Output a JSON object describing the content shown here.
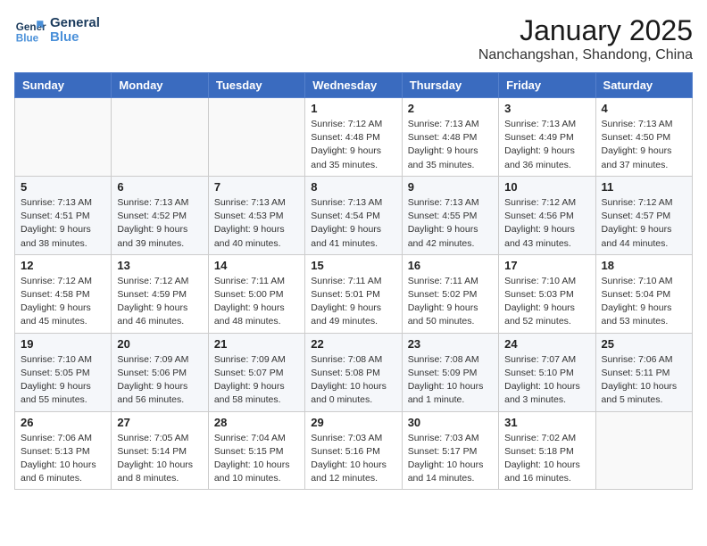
{
  "logo": {
    "line1": "General",
    "line2": "Blue"
  },
  "title": "January 2025",
  "location": "Nanchangshan, Shandong, China",
  "weekdays": [
    "Sunday",
    "Monday",
    "Tuesday",
    "Wednesday",
    "Thursday",
    "Friday",
    "Saturday"
  ],
  "weeks": [
    [
      {
        "day": "",
        "info": ""
      },
      {
        "day": "",
        "info": ""
      },
      {
        "day": "",
        "info": ""
      },
      {
        "day": "1",
        "info": "Sunrise: 7:12 AM\nSunset: 4:48 PM\nDaylight: 9 hours\nand 35 minutes."
      },
      {
        "day": "2",
        "info": "Sunrise: 7:13 AM\nSunset: 4:48 PM\nDaylight: 9 hours\nand 35 minutes."
      },
      {
        "day": "3",
        "info": "Sunrise: 7:13 AM\nSunset: 4:49 PM\nDaylight: 9 hours\nand 36 minutes."
      },
      {
        "day": "4",
        "info": "Sunrise: 7:13 AM\nSunset: 4:50 PM\nDaylight: 9 hours\nand 37 minutes."
      }
    ],
    [
      {
        "day": "5",
        "info": "Sunrise: 7:13 AM\nSunset: 4:51 PM\nDaylight: 9 hours\nand 38 minutes."
      },
      {
        "day": "6",
        "info": "Sunrise: 7:13 AM\nSunset: 4:52 PM\nDaylight: 9 hours\nand 39 minutes."
      },
      {
        "day": "7",
        "info": "Sunrise: 7:13 AM\nSunset: 4:53 PM\nDaylight: 9 hours\nand 40 minutes."
      },
      {
        "day": "8",
        "info": "Sunrise: 7:13 AM\nSunset: 4:54 PM\nDaylight: 9 hours\nand 41 minutes."
      },
      {
        "day": "9",
        "info": "Sunrise: 7:13 AM\nSunset: 4:55 PM\nDaylight: 9 hours\nand 42 minutes."
      },
      {
        "day": "10",
        "info": "Sunrise: 7:12 AM\nSunset: 4:56 PM\nDaylight: 9 hours\nand 43 minutes."
      },
      {
        "day": "11",
        "info": "Sunrise: 7:12 AM\nSunset: 4:57 PM\nDaylight: 9 hours\nand 44 minutes."
      }
    ],
    [
      {
        "day": "12",
        "info": "Sunrise: 7:12 AM\nSunset: 4:58 PM\nDaylight: 9 hours\nand 45 minutes."
      },
      {
        "day": "13",
        "info": "Sunrise: 7:12 AM\nSunset: 4:59 PM\nDaylight: 9 hours\nand 46 minutes."
      },
      {
        "day": "14",
        "info": "Sunrise: 7:11 AM\nSunset: 5:00 PM\nDaylight: 9 hours\nand 48 minutes."
      },
      {
        "day": "15",
        "info": "Sunrise: 7:11 AM\nSunset: 5:01 PM\nDaylight: 9 hours\nand 49 minutes."
      },
      {
        "day": "16",
        "info": "Sunrise: 7:11 AM\nSunset: 5:02 PM\nDaylight: 9 hours\nand 50 minutes."
      },
      {
        "day": "17",
        "info": "Sunrise: 7:10 AM\nSunset: 5:03 PM\nDaylight: 9 hours\nand 52 minutes."
      },
      {
        "day": "18",
        "info": "Sunrise: 7:10 AM\nSunset: 5:04 PM\nDaylight: 9 hours\nand 53 minutes."
      }
    ],
    [
      {
        "day": "19",
        "info": "Sunrise: 7:10 AM\nSunset: 5:05 PM\nDaylight: 9 hours\nand 55 minutes."
      },
      {
        "day": "20",
        "info": "Sunrise: 7:09 AM\nSunset: 5:06 PM\nDaylight: 9 hours\nand 56 minutes."
      },
      {
        "day": "21",
        "info": "Sunrise: 7:09 AM\nSunset: 5:07 PM\nDaylight: 9 hours\nand 58 minutes."
      },
      {
        "day": "22",
        "info": "Sunrise: 7:08 AM\nSunset: 5:08 PM\nDaylight: 10 hours\nand 0 minutes."
      },
      {
        "day": "23",
        "info": "Sunrise: 7:08 AM\nSunset: 5:09 PM\nDaylight: 10 hours\nand 1 minute."
      },
      {
        "day": "24",
        "info": "Sunrise: 7:07 AM\nSunset: 5:10 PM\nDaylight: 10 hours\nand 3 minutes."
      },
      {
        "day": "25",
        "info": "Sunrise: 7:06 AM\nSunset: 5:11 PM\nDaylight: 10 hours\nand 5 minutes."
      }
    ],
    [
      {
        "day": "26",
        "info": "Sunrise: 7:06 AM\nSunset: 5:13 PM\nDaylight: 10 hours\nand 6 minutes."
      },
      {
        "day": "27",
        "info": "Sunrise: 7:05 AM\nSunset: 5:14 PM\nDaylight: 10 hours\nand 8 minutes."
      },
      {
        "day": "28",
        "info": "Sunrise: 7:04 AM\nSunset: 5:15 PM\nDaylight: 10 hours\nand 10 minutes."
      },
      {
        "day": "29",
        "info": "Sunrise: 7:03 AM\nSunset: 5:16 PM\nDaylight: 10 hours\nand 12 minutes."
      },
      {
        "day": "30",
        "info": "Sunrise: 7:03 AM\nSunset: 5:17 PM\nDaylight: 10 hours\nand 14 minutes."
      },
      {
        "day": "31",
        "info": "Sunrise: 7:02 AM\nSunset: 5:18 PM\nDaylight: 10 hours\nand 16 minutes."
      },
      {
        "day": "",
        "info": ""
      }
    ]
  ]
}
